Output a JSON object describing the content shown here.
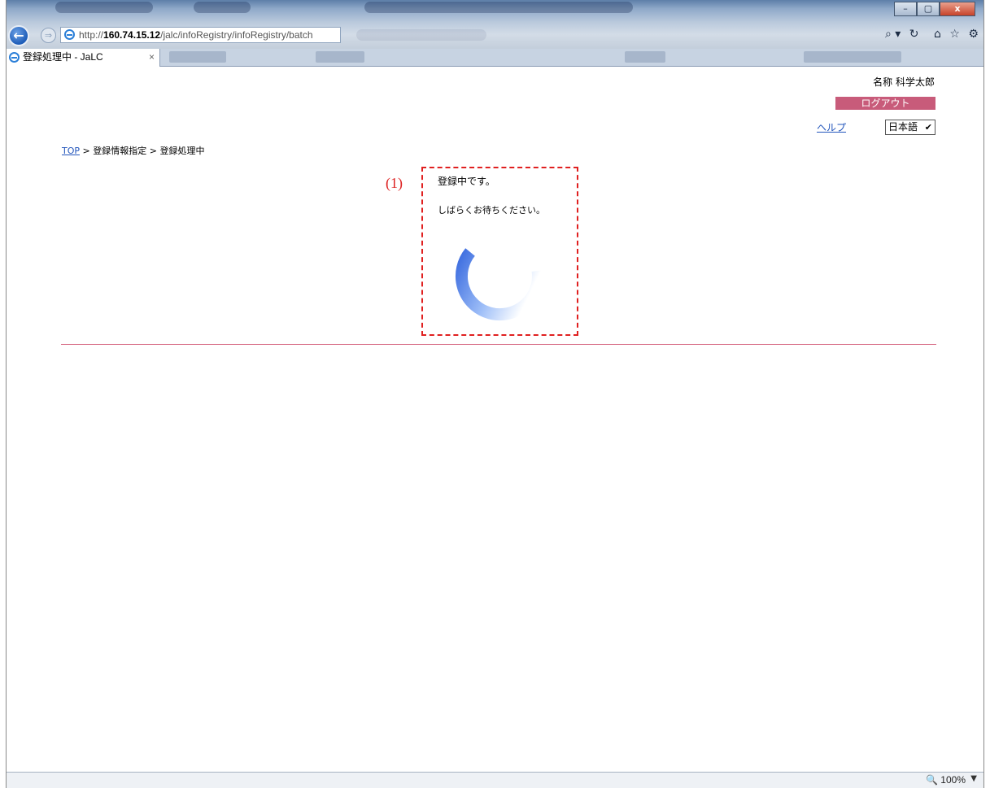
{
  "browser": {
    "url_prefix": "http://",
    "url_host": "160.74.15.12",
    "url_path": "/jalc/infoRegistry/infoRegistry/batch",
    "tab_title": "登録処理中 - JaLC",
    "tab_close": "×",
    "window_buttons": {
      "minimize": "–",
      "maximize": "▢",
      "close": "x"
    },
    "tools": {
      "search": "⌕ ▾",
      "refresh": "↻",
      "home": "⌂",
      "favorites": "☆",
      "settings": "⚙"
    },
    "zoom": "100%",
    "zoom_icon": "zoom-icon"
  },
  "header": {
    "user_name": "名称 科学太郎",
    "logout_label": "ログアウト",
    "help_label": "ヘルプ",
    "language_selected": "日本語",
    "logout_color": "#c85b7a"
  },
  "breadcrumb": {
    "top": "TOP",
    "sep1": " > ",
    "item2": "登録情報指定",
    "sep2": " > ",
    "item3": "登録処理中"
  },
  "main": {
    "annotation": "(1)",
    "message1": "登録中です。",
    "message2": "しばらくお待ちください。",
    "spinner_colors": {
      "start": "#3f6fe0",
      "end": "#ffffff"
    }
  }
}
